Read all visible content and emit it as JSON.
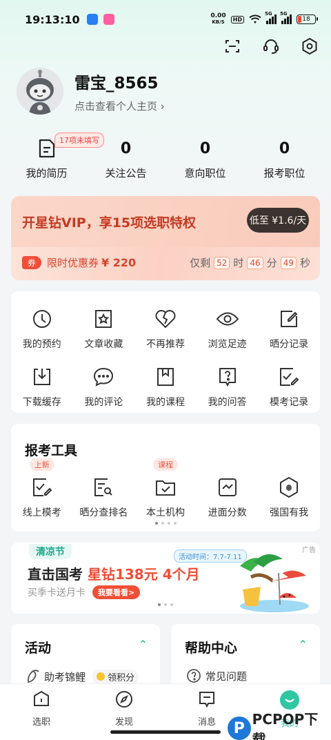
{
  "status": {
    "time": "13:10",
    "time_prefix": "19:",
    "net_speed_top": "0.00",
    "net_speed_unit": "KB/S",
    "hd": "HD",
    "sig1": "5G",
    "sig2": "5G",
    "battery": "18"
  },
  "profile": {
    "name": "雷宝_8565",
    "link": "点击查看个人主页 ›"
  },
  "stats": [
    {
      "num": "",
      "label": "我的简历",
      "badge": "17项未填写"
    },
    {
      "num": "0",
      "label": "关注公告"
    },
    {
      "num": "0",
      "label": "意向职位"
    },
    {
      "num": "0",
      "label": "报考职位"
    }
  ],
  "vip": {
    "title": "开星钻VIP，享15项选职特权",
    "button": "低至 ¥1.6/天",
    "coupon_tag": "券",
    "coupon_text": "限时优惠券",
    "coupon_amount": "¥ 220",
    "remain": "仅剩",
    "h": "52",
    "h_unit": "时",
    "m": "46",
    "m_unit": "分",
    "s": "49",
    "s_unit": "秒"
  },
  "shortcuts": [
    {
      "label": "我的预约",
      "icon": "clock-icon"
    },
    {
      "label": "文章收藏",
      "icon": "star-bookmark-icon"
    },
    {
      "label": "不再推荐",
      "icon": "broken-heart-icon"
    },
    {
      "label": "浏览足迹",
      "icon": "eye-icon"
    },
    {
      "label": "晒分记录",
      "icon": "edit-note-icon"
    },
    {
      "label": "下载缓存",
      "icon": "download-icon"
    },
    {
      "label": "我的评论",
      "icon": "comment-icon"
    },
    {
      "label": "我的课程",
      "icon": "book-icon"
    },
    {
      "label": "我的问答",
      "icon": "question-icon"
    },
    {
      "label": "模考记录",
      "icon": "exam-record-icon"
    }
  ],
  "tools": {
    "title": "报考工具",
    "items": [
      {
        "label": "线上模考",
        "tag": "上新",
        "icon": "mock-exam-icon"
      },
      {
        "label": "晒分查排名",
        "tag": "",
        "icon": "rank-search-icon"
      },
      {
        "label": "本土机构",
        "tag": "课程",
        "icon": "folder-check-icon"
      },
      {
        "label": "进面分数",
        "tag": "",
        "icon": "score-chart-icon"
      },
      {
        "label": "强国有我",
        "tag": "",
        "icon": "shield-flower-icon"
      }
    ]
  },
  "banner": {
    "tag": "清凉节",
    "ad": "广告",
    "headline_a": "直击国考",
    "headline_b": "星钻138元",
    "headline_c": "4个月",
    "sub": "买季卡送月卡",
    "cta": "我要看看>",
    "period": "活动时间：7.7-7.11"
  },
  "activity": {
    "title": "活动",
    "item": "助考锦鲤",
    "badge": "领积分"
  },
  "help": {
    "title": "帮助中心",
    "item": "常见问题"
  },
  "nav": [
    {
      "label": "选职",
      "icon": "home-icon"
    },
    {
      "label": "发现",
      "icon": "compass-icon"
    },
    {
      "label": "消息",
      "icon": "message-icon"
    },
    {
      "label": "我的",
      "icon": "profile-face-icon"
    }
  ],
  "watermark": "PCPOP下载",
  "colors": {
    "accent": "#2fc7a2",
    "red": "#e34d33",
    "vip_bg": "#fbd7c8"
  }
}
